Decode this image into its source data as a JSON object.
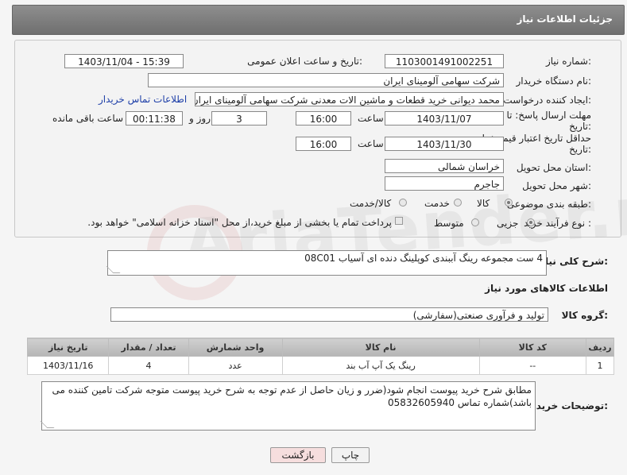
{
  "header": {
    "title": "جزئیات اطلاعات نیاز"
  },
  "form": {
    "need_number": {
      "label": "شماره نیاز:",
      "value": "1103001491002251"
    },
    "announce_datetime": {
      "label": "تاریخ و ساعت اعلان عمومی:",
      "value": "1403/11/04 - 15:39"
    },
    "buyer_org": {
      "label": "نام دستگاه خریدار:",
      "value": "شرکت سهامی آلومینای ایران"
    },
    "requester": {
      "label": "ایجاد کننده درخواست:",
      "value": "محمد دیوانی خرید قطعات و ماشین الات معدنی شرکت سهامی آلومینای ایران",
      "contact_link": "اطلاعات تماس خریدار"
    },
    "reply_deadline": {
      "label_line1": "مهلت ارسال پاسخ: تا",
      "label_line2": "تاریخ:",
      "date": "1403/11/07",
      "time_label": "ساعت",
      "time": "16:00",
      "days": "3",
      "days_label": "روز و",
      "remaining": "00:11:38",
      "remaining_label": "ساعت باقی مانده"
    },
    "price_validity": {
      "label_line1": "حداقل تاریخ اعتبار قیمت: تا",
      "label_line2": "تاریخ:",
      "date": "1403/11/30",
      "time_label": "ساعت",
      "time": "16:00"
    },
    "province": {
      "label": "استان محل تحویل:",
      "value": "خراسان شمالی"
    },
    "city": {
      "label": "شهر محل تحویل:",
      "value": "جاجرم"
    },
    "category": {
      "label": "طبقه بندی موضوعی:",
      "options": [
        "کالا",
        "خدمت",
        "کالا/خدمت"
      ],
      "selected": "کالا"
    },
    "process_type": {
      "label": "نوع فرآیند خرید :",
      "options": [
        "جزیی",
        "متوسط"
      ],
      "selected": "جزیی",
      "payment_note": "پرداخت تمام یا بخشی از مبلغ خرید،از محل \"اسناد خزانه اسلامی\" خواهد بود."
    }
  },
  "summary": {
    "label": "شرح کلی نیاز:",
    "value": "4 ست مجموعه رینگ آببندی کوپلینگ دنده ای  آسیاب 08C01"
  },
  "goods_info": {
    "title": "اطلاعات کالاهای مورد نیاز"
  },
  "goods_group": {
    "label": "گروه کالا:",
    "value": "تولید و فرآوری صنعتی(سفارشی)"
  },
  "table": {
    "headers": [
      "ردیف",
      "کد کالا",
      "نام کالا",
      "واحد شمارش",
      "تعداد / مقدار",
      "تاریخ نیاز"
    ],
    "rows": [
      [
        "1",
        "--",
        "رینگ یک آپ آب بند",
        "عدد",
        "4",
        "1403/11/16"
      ]
    ]
  },
  "buyer_notes": {
    "label": "توضیحات خریدار:",
    "value": "مطابق شرح خرید پیوست انجام شود(ضرر و زیان حاصل از عدم توجه به شرح خرید پیوست متوجه شرکت تامین کننده می باشد)شماره تماس 05832605940"
  },
  "buttons": {
    "print": "چاپ",
    "back": "بازگشت"
  },
  "watermark": "AriaTender.neT",
  "colors": {
    "header_bg": "#7f7f7f",
    "link": "#1e3fa8",
    "back_button": "#f6dede"
  }
}
